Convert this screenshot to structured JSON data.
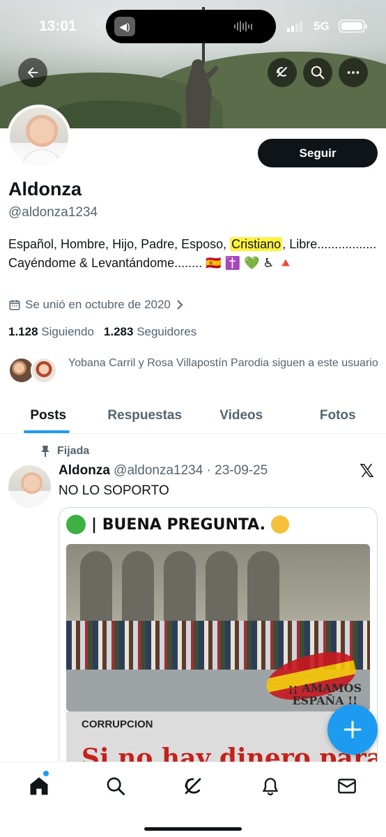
{
  "status_bar": {
    "time": "13:01",
    "network": "5G"
  },
  "profile": {
    "name": "Aldonza",
    "handle": "@aldonza1234",
    "follow_label": "Seguir",
    "bio_before": "Español, Hombre, Hijo, Padre, Esposo, ",
    "bio_highlight": "Cristiano",
    "bio_after": ", Libre................. Cayéndome & Levantándome........ 🇪🇸 ✝️ 💚 ♿ 🔺",
    "joined": "Se unió en octubre de 2020",
    "following_count": "1.128",
    "following_label": "Siguiendo",
    "followers_count": "1.283",
    "followers_label": "Seguidores",
    "followed_by": "Yobana Carril y Rosa Villapostín Parodia siguen a este usuario"
  },
  "tabs": [
    {
      "label": "Posts",
      "active": true
    },
    {
      "label": "Respuestas",
      "active": false
    },
    {
      "label": "Videos",
      "active": false
    },
    {
      "label": "Fotos",
      "active": false
    }
  ],
  "post": {
    "pinned_label": "Fijada",
    "author": "Aldonza",
    "meta": "@aldonza1234 · 23-09-25",
    "text": "NO LO SOPORTO",
    "image": {
      "headline": "| BUENA PREGUNTA.",
      "overlay_1": "¡¡ AMAMOS",
      "overlay_2": "ESPAÑA !!",
      "caption_small": "CORRUPCION",
      "caption_big": "Si no hay dinero para"
    }
  },
  "icons": {
    "back": "back-arrow-icon",
    "grok": "grok-icon",
    "search": "search-icon",
    "more": "more-icon",
    "calendar": "calendar-icon",
    "pin": "pin-icon",
    "x_logo": "x-logo-icon",
    "compose": "plus-icon",
    "home": "home-icon",
    "bell": "bell-icon",
    "mail": "mail-icon"
  },
  "colors": {
    "accent": "#1d9bf0",
    "highlight": "#fff23c",
    "text": "#0f1419",
    "muted": "#536471"
  }
}
